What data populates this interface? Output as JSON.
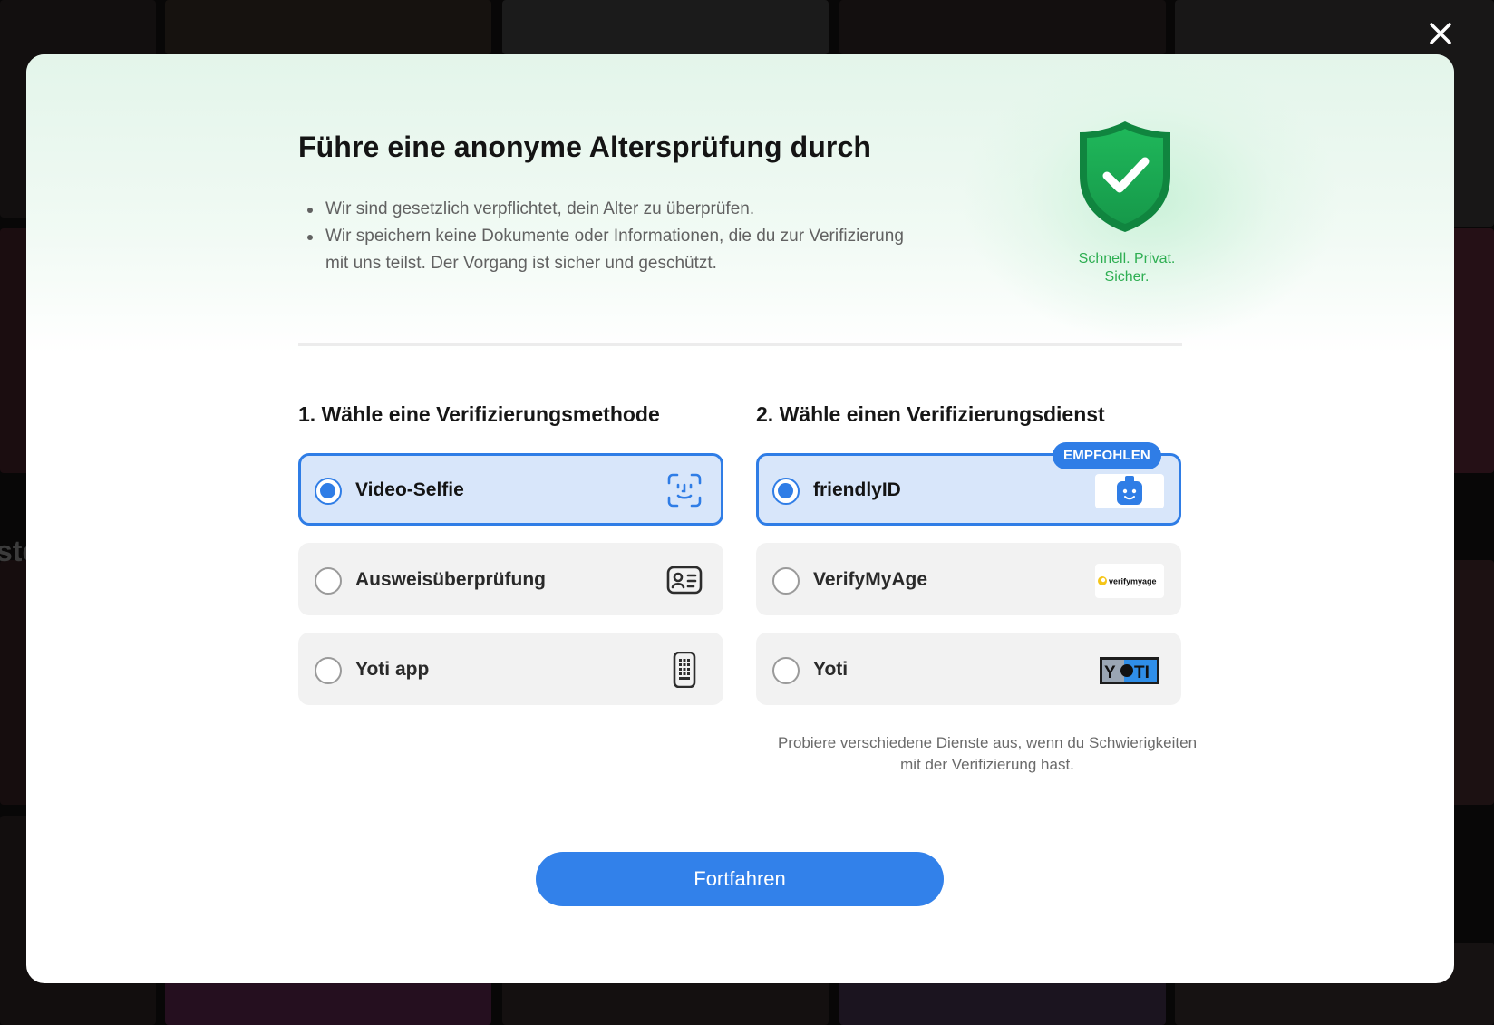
{
  "backdrop": {
    "partial_text": "ste"
  },
  "modal": {
    "close_icon": "close-icon",
    "title": "Führe eine anonyme Altersprüfung durch",
    "bullets": [
      "Wir sind gesetzlich verpflichtet, dein Alter zu überprüfen.",
      "Wir speichern keine Dokumente oder Informationen, die du zur Verifizierung mit uns teilst. Der Vorgang ist sicher und geschützt."
    ],
    "trust": {
      "icon": "shield-check-icon",
      "line1": "Schnell. Privat.",
      "line2": "Sicher."
    },
    "methods": {
      "heading": "1. Wähle eine Verifizierungsmethode",
      "options": [
        {
          "label": "Video-Selfie",
          "icon": "face-scan-icon",
          "selected": true
        },
        {
          "label": "Ausweisüberprüfung",
          "icon": "id-card-icon",
          "selected": false
        },
        {
          "label": "Yoti app",
          "icon": "phone-keypad-icon",
          "selected": false
        }
      ]
    },
    "services": {
      "heading": "2. Wähle einen Verifizierungsdienst",
      "badge": "EMPFOHLEN",
      "options": [
        {
          "label": "friendlyID",
          "logo": "friendlyid-logo",
          "selected": true
        },
        {
          "label": "VerifyMyAge",
          "logo": "verifymyage-logo",
          "logo_text": "verifymyage",
          "selected": false
        },
        {
          "label": "Yoti",
          "logo": "yoti-logo",
          "logo_text_a": "Y",
          "logo_text_b": "TI",
          "selected": false
        }
      ],
      "hint": "Probiere verschiedene Dienste aus, wenn du Schwierigkeiten mit der Verifizierung hast."
    },
    "continue_label": "Fortfahren"
  },
  "colors": {
    "accent": "#2f7de6",
    "selected_bg": "#d8e6fa",
    "option_bg": "#f2f2f2",
    "success_green": "#2eae52"
  }
}
